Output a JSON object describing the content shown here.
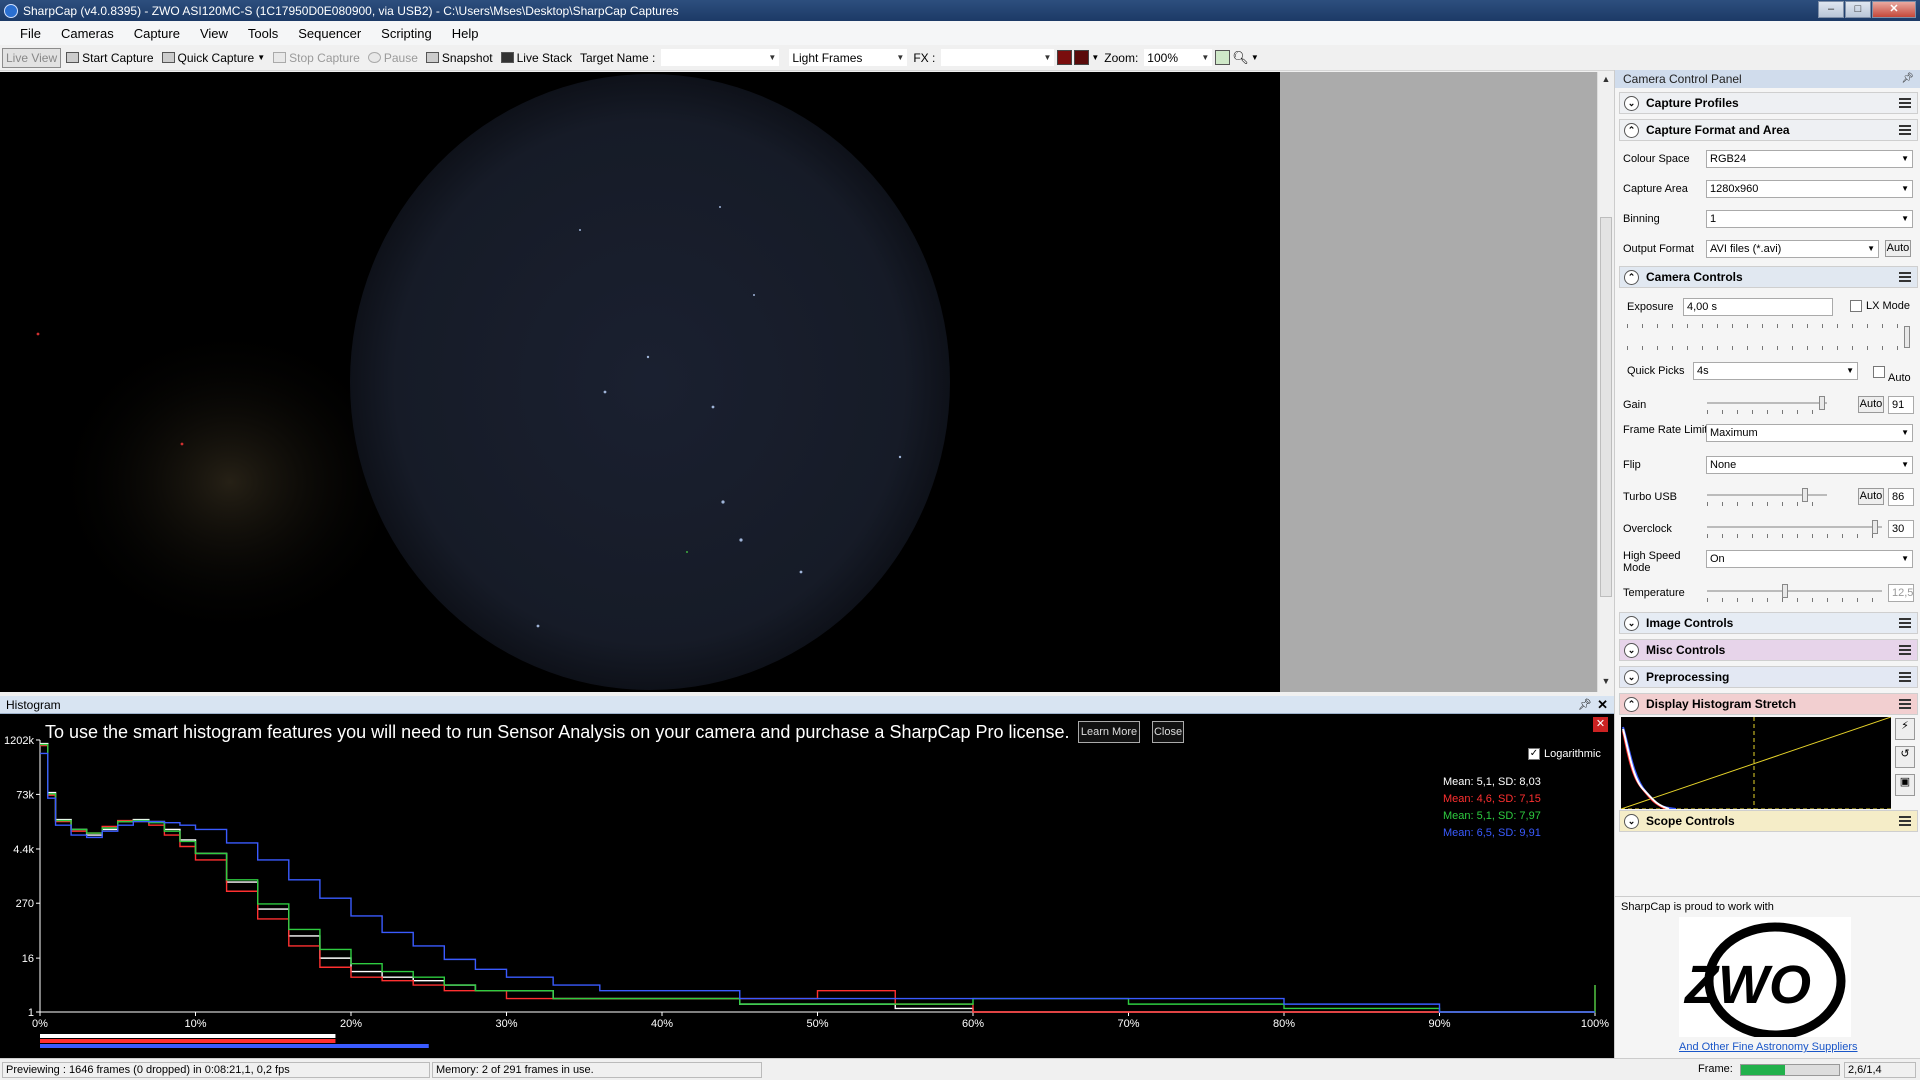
{
  "window": {
    "title": "SharpCap (v4.0.8395) - ZWO ASI120MC-S (1C17950D0E080900, via USB2) - C:\\Users\\Mses\\Desktop\\SharpCap Captures"
  },
  "menu": [
    "File",
    "Cameras",
    "Capture",
    "View",
    "Tools",
    "Sequencer",
    "Scripting",
    "Help"
  ],
  "toolbar": {
    "live_view": "Live View",
    "start_capture": "Start Capture",
    "quick_capture": "Quick Capture",
    "stop_capture": "Stop Capture",
    "pause": "Pause",
    "snapshot": "Snapshot",
    "live_stack": "Live Stack",
    "target_name_label": "Target Name :",
    "target_name_value": "",
    "frame_type": "Light Frames",
    "fx_label": "FX :",
    "fx_value": "",
    "zoom_label": "Zoom:",
    "zoom_value": "100%"
  },
  "histogram": {
    "title": "Histogram",
    "banner": "To use the smart histogram features you will need to run Sensor Analysis on your camera and purchase a SharpCap Pro license.",
    "learn_more": "Learn More",
    "close": "Close",
    "logarithmic_label": "Logarithmic",
    "logarithmic": true,
    "stats": [
      {
        "text": "Mean: 5,1, SD: 8,03",
        "color": "#ffffff"
      },
      {
        "text": "Mean: 4,6, SD: 7,15",
        "color": "#ff3030"
      },
      {
        "text": "Mean: 5,1, SD: 7,97",
        "color": "#2ecc40"
      },
      {
        "text": "Mean: 6,5, SD: 9,91",
        "color": "#3a5bff"
      }
    ]
  },
  "chart_data": {
    "type": "line",
    "title": "Histogram",
    "y_scale": "log",
    "ylim": [
      1,
      1200000
    ],
    "yticks": [
      "1202k",
      "73k",
      "4.4k",
      "270",
      "16",
      "1"
    ],
    "xticks": [
      "0%",
      "10%",
      "20%",
      "30%",
      "40%",
      "50%",
      "60%",
      "70%",
      "80%",
      "90%",
      "100%"
    ],
    "xlim": [
      0,
      100
    ],
    "x": [
      0,
      0.5,
      1,
      2,
      3,
      4,
      5,
      6,
      7,
      8,
      9,
      10,
      12,
      14,
      16,
      18,
      20,
      22,
      24,
      26,
      28,
      30,
      33,
      36,
      40,
      45,
      50,
      55,
      60,
      70,
      80,
      90,
      100
    ],
    "series": [
      {
        "color": "#ffffff",
        "values": [
          1000000,
          80000,
          20000,
          12000,
          9000,
          12000,
          18000,
          20000,
          18000,
          12000,
          7000,
          3500,
          800,
          200,
          50,
          16,
          8,
          6,
          5,
          4,
          3,
          3,
          2,
          2,
          2,
          1.5,
          1.5,
          1.2,
          1,
          1,
          1,
          1,
          1
        ]
      },
      {
        "color": "#ff3030",
        "values": [
          900000,
          70000,
          18000,
          11000,
          10000,
          14000,
          19000,
          18000,
          15000,
          9000,
          5000,
          2500,
          500,
          120,
          30,
          10,
          6,
          5,
          4,
          3,
          3,
          2,
          2,
          2,
          2,
          2,
          3,
          1.5,
          1,
          1,
          1,
          1,
          4
        ]
      },
      {
        "color": "#2ecc40",
        "values": [
          950000,
          75000,
          19000,
          12000,
          10000,
          13000,
          18000,
          19000,
          17000,
          11000,
          6500,
          3500,
          900,
          260,
          70,
          25,
          12,
          8,
          6,
          4,
          3,
          3,
          2,
          2,
          2,
          1.5,
          1.5,
          1.5,
          2,
          1.5,
          1.2,
          1,
          4
        ]
      },
      {
        "color": "#3a5bff",
        "values": [
          600000,
          60000,
          15000,
          9000,
          8000,
          11000,
          15000,
          18000,
          18000,
          17000,
          15000,
          12000,
          6000,
          2500,
          900,
          350,
          140,
          60,
          30,
          15,
          9,
          6,
          4,
          3,
          3,
          2,
          2,
          2,
          2,
          2,
          1.5,
          1,
          1
        ]
      }
    ]
  },
  "panel": {
    "title": "Camera Control Panel",
    "capture_profiles": "Capture Profiles",
    "capture_format": "Capture Format and Area",
    "colour_space_label": "Colour Space",
    "colour_space": "RGB24",
    "capture_area_label": "Capture Area",
    "capture_area": "1280x960",
    "binning_label": "Binning",
    "binning": "1",
    "output_format_label": "Output Format",
    "output_format": "AVI files (*.avi)",
    "auto": "Auto",
    "camera_controls": "Camera Controls",
    "exposure_label": "Exposure",
    "exposure": "4,00 s",
    "lx_mode": "LX Mode",
    "quick_picks_label": "Quick Picks",
    "quick_picks": "4s",
    "gain_label": "Gain",
    "gain": "91",
    "frame_rate_label": "Frame Rate Limit",
    "frame_rate": "Maximum",
    "flip_label": "Flip",
    "flip": "None",
    "turbo_usb_label": "Turbo USB",
    "turbo_usb": "86",
    "overclock_label": "Overclock",
    "overclock": "30",
    "high_speed_label": "High Speed Mode",
    "high_speed": "On",
    "temperature_label": "Temperature",
    "temperature": "12,5",
    "image_controls": "Image Controls",
    "misc_controls": "Misc Controls",
    "preprocessing": "Preprocessing",
    "display_stretch": "Display Histogram Stretch",
    "scope_controls": "Scope Controls",
    "sponsor_text": "SharpCap is proud to work with",
    "sponsor_link": "And Other Fine Astronomy Suppliers",
    "logo_text": "ZWO"
  },
  "status": {
    "previewing": "Previewing : 1646 frames (0 dropped) in 0:08:21,1, 0,2 fps",
    "memory": "Memory: 2 of 291 frames in use.",
    "frame_label": "Frame:",
    "frame_progress": 0.45,
    "version": "2,6/1,4"
  }
}
